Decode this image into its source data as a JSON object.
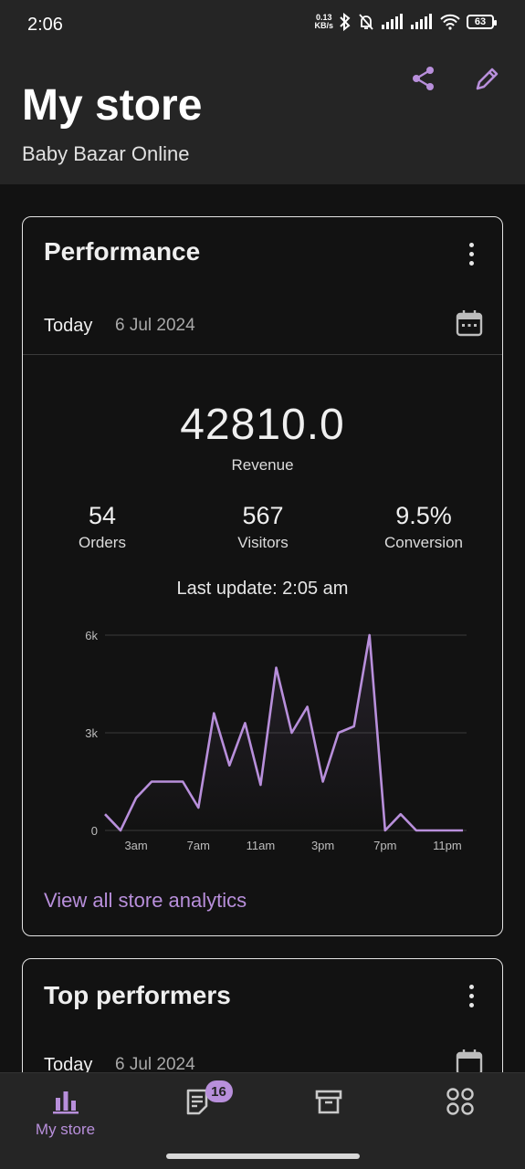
{
  "status_bar": {
    "time": "2:06",
    "net_speed_value": "0.13",
    "net_speed_unit": "KB/s",
    "battery": "63"
  },
  "header": {
    "title": "My store",
    "store_name": "Baby Bazar Online",
    "share_icon": "share-icon",
    "edit_icon": "pencil-icon",
    "accent": "#b88fdb"
  },
  "performance": {
    "title": "Performance",
    "date_range": "Today",
    "date": "6 Jul 2024",
    "revenue_value": "42810.0",
    "revenue_label": "Revenue",
    "stats": [
      {
        "value": "54",
        "label": "Orders"
      },
      {
        "value": "567",
        "label": "Visitors"
      },
      {
        "value": "9.5%",
        "label": "Conversion"
      }
    ],
    "last_update": "Last update: 2:05 am",
    "view_link": "View all store analytics"
  },
  "chart_data": {
    "type": "line",
    "title": "",
    "xlabel": "",
    "ylabel": "",
    "ylim": [
      0,
      6000
    ],
    "y_ticks": [
      "0",
      "3k",
      "6k"
    ],
    "x_tick_labels": [
      "3am",
      "7am",
      "11am",
      "3pm",
      "7pm",
      "11pm"
    ],
    "grid": true,
    "color": "#b88fdb",
    "x": [
      0,
      1,
      2,
      3,
      4,
      5,
      6,
      7,
      8,
      9,
      10,
      11,
      12,
      13,
      14,
      15,
      16,
      17,
      18,
      19,
      20,
      21,
      22,
      23
    ],
    "series": [
      {
        "values": [
          500,
          0,
          1000,
          1500,
          1500,
          1500,
          700,
          3600,
          2000,
          3300,
          1400,
          5000,
          3000,
          3800,
          1500,
          3000,
          3200,
          6000,
          0,
          500,
          0,
          0,
          0,
          0
        ]
      }
    ]
  },
  "top_performers": {
    "title": "Top performers",
    "date_range": "Today",
    "date": "6 Jul 2024"
  },
  "bottom_nav": {
    "items": [
      {
        "label": "My store",
        "icon": "bar-chart-icon"
      },
      {
        "label": "",
        "icon": "orders-icon",
        "badge": "16"
      },
      {
        "label": "",
        "icon": "archive-icon"
      },
      {
        "label": "",
        "icon": "grid-menu-icon"
      }
    ]
  }
}
